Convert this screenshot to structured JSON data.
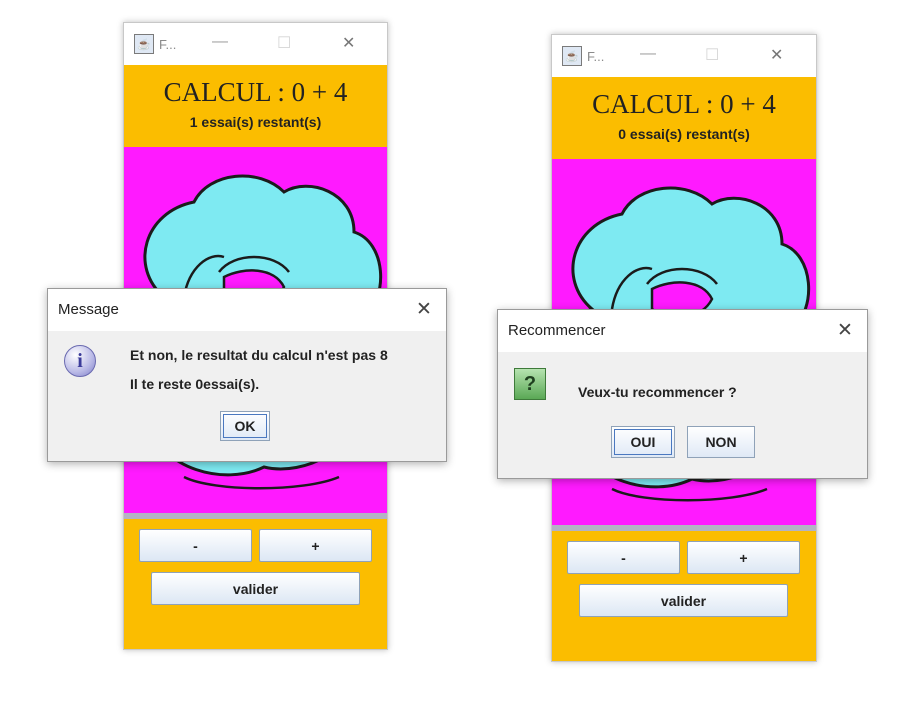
{
  "window_left": {
    "title": "F...",
    "calc_label": "CALCUL : 0 + 4",
    "tries_label": "1  essai(s) restant(s)",
    "minus": "-",
    "plus": "+",
    "validate": "valider"
  },
  "window_right": {
    "title": "F...",
    "calc_label": "CALCUL : 0 + 4",
    "tries_label": "0  essai(s) restant(s)",
    "minus": "-",
    "plus": "+",
    "validate": "valider"
  },
  "dialog_message": {
    "title": "Message",
    "line1": "Et non, le resultat du calcul n'est pas 8",
    "line2": "Il te reste 0essai(s).",
    "ok": "OK",
    "icon": "info-icon"
  },
  "dialog_restart": {
    "title": "Recommencer",
    "question": "Veux-tu recommencer ?",
    "yes": "OUI",
    "no": "NON",
    "icon": "question-icon"
  },
  "colors": {
    "header_bg": "#fbbd00",
    "panel_bg": "#ff1aff",
    "cloud_fill": "#7eeaf2"
  },
  "window_controls": {
    "minimize": "—",
    "maximize": "☐",
    "close": "✕"
  }
}
